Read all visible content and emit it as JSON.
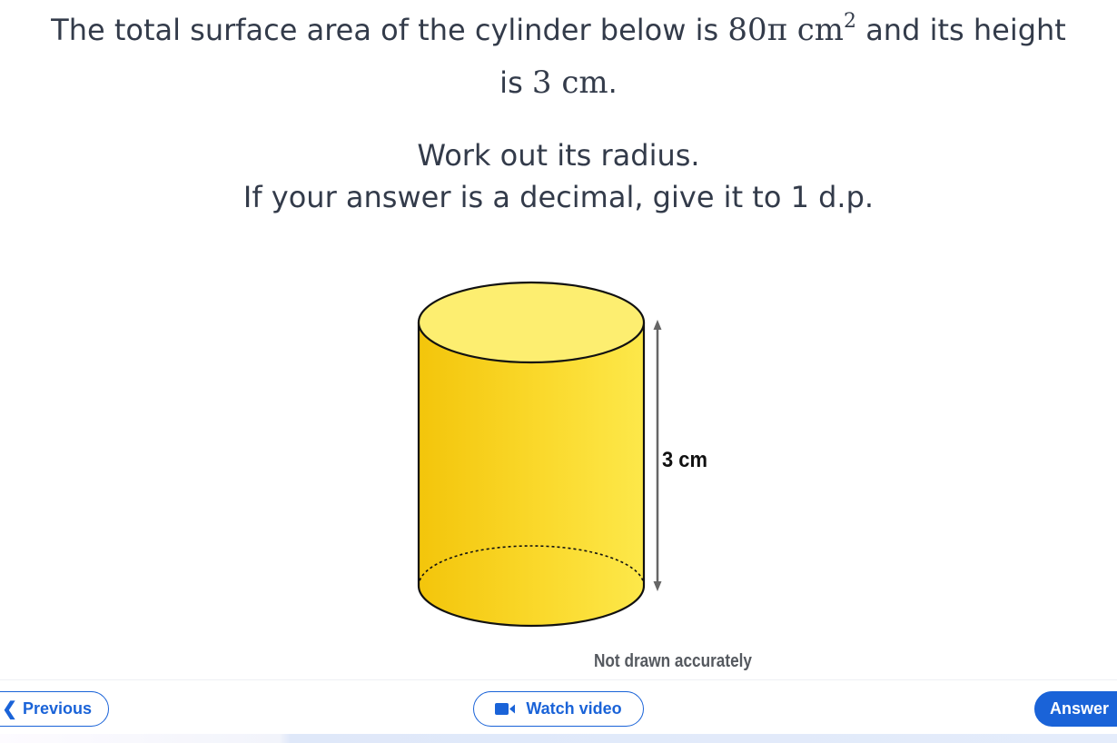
{
  "question": {
    "line1_pre": "The total surface area of the cylinder below is ",
    "area_value": "80π cm",
    "area_exponent": "2",
    "line1_post": " and its height",
    "line2_pre": "is ",
    "height_value": "3 cm",
    "line2_post": "."
  },
  "instructions": {
    "line1": "Work out its radius.",
    "line2": "If your answer is a decimal, give it to 1 d.p."
  },
  "figure": {
    "height_label": "3 cm",
    "caption": "Not drawn accurately",
    "colors": {
      "top_fill": "#fdee70",
      "body_dark": "#f3c50b",
      "body_light": "#fde84a",
      "outline": "#111111",
      "arrow": "#666666"
    }
  },
  "nav": {
    "previous_label": "Previous",
    "watch_video_label": "Watch video",
    "answer_label": "Answer",
    "accent": "#1a63d8"
  }
}
